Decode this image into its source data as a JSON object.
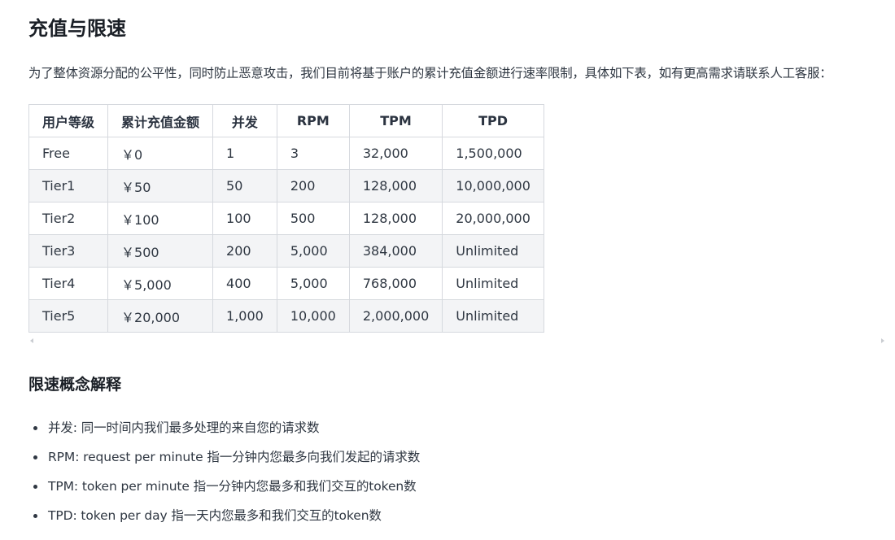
{
  "title": "充值与限速",
  "intro": "为了整体资源分配的公平性，同时防止恶意攻击，我们目前将基于账户的累计充值金额进行速率限制，具体如下表，如有更高需求请联系人工客服：",
  "table": {
    "headers": [
      "用户等级",
      "累计充值金额",
      "并发",
      "RPM",
      "TPM",
      "TPD"
    ],
    "rows": [
      [
        "Free",
        "￥0",
        "1",
        "3",
        "32,000",
        "1,500,000"
      ],
      [
        "Tier1",
        "￥50",
        "50",
        "200",
        "128,000",
        "10,000,000"
      ],
      [
        "Tier2",
        "￥100",
        "100",
        "500",
        "128,000",
        "20,000,000"
      ],
      [
        "Tier3",
        "￥500",
        "200",
        "5,000",
        "384,000",
        "Unlimited"
      ],
      [
        "Tier4",
        "￥5,000",
        "400",
        "5,000",
        "768,000",
        "Unlimited"
      ],
      [
        "Tier5",
        "￥20,000",
        "1,000",
        "10,000",
        "2,000,000",
        "Unlimited"
      ]
    ]
  },
  "section": {
    "title": "限速概念解释",
    "items": [
      "并发: 同一时间内我们最多处理的来自您的请求数",
      "RPM: request per minute 指一分钟内您最多向我们发起的请求数",
      "TPM: token per minute 指一分钟内您最多和我们交互的token数",
      "TPD: token per day 指一天内您最多和我们交互的token数"
    ]
  },
  "icons": {
    "scroll_left": "triangle-left-icon",
    "scroll_right": "triangle-right-icon"
  },
  "colors": {
    "text": "#2f3742",
    "heading": "#1a1f26",
    "border": "#d6d9de",
    "stripe": "#f3f4f6"
  }
}
